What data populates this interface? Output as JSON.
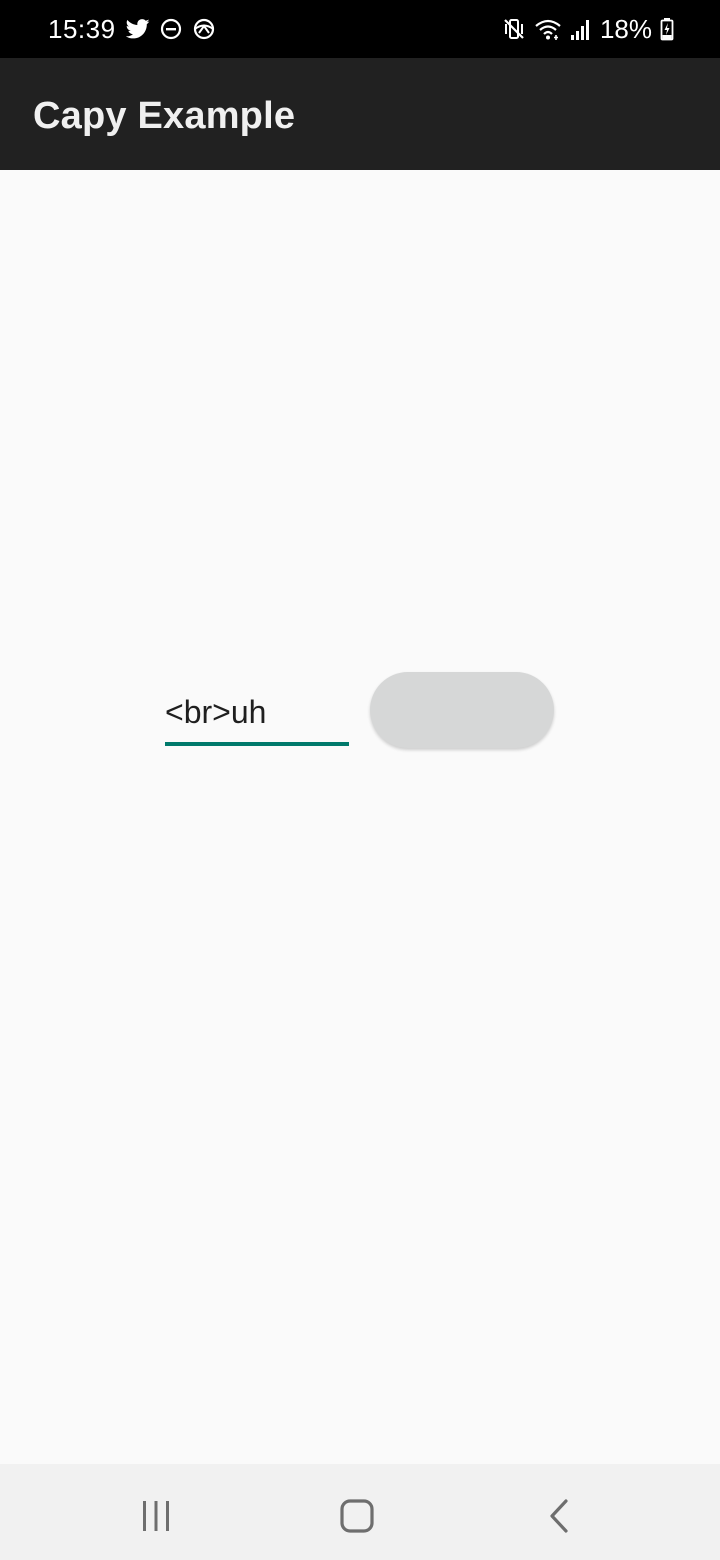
{
  "status_bar": {
    "time": "15:39",
    "battery": "18%",
    "icons_left": [
      "twitter-icon",
      "do-not-disturb-icon",
      "sync-icon"
    ],
    "icons_right": [
      "mute-vibrate-icon",
      "wifi-icon",
      "signal-icon",
      "battery-charging-icon"
    ]
  },
  "app_bar": {
    "title": "Capy Example"
  },
  "main": {
    "text_field": {
      "value": "<br>uh"
    },
    "button": {
      "label": ""
    }
  },
  "nav_bar": {
    "icons": [
      "recents-icon",
      "home-icon",
      "back-icon"
    ]
  },
  "colors": {
    "status_bar": "#000000",
    "app_bar": "#212121",
    "background": "#fafafa",
    "accent": "#00796b",
    "button": "#d6d7d7",
    "nav_bar": "#f1f1f1"
  }
}
